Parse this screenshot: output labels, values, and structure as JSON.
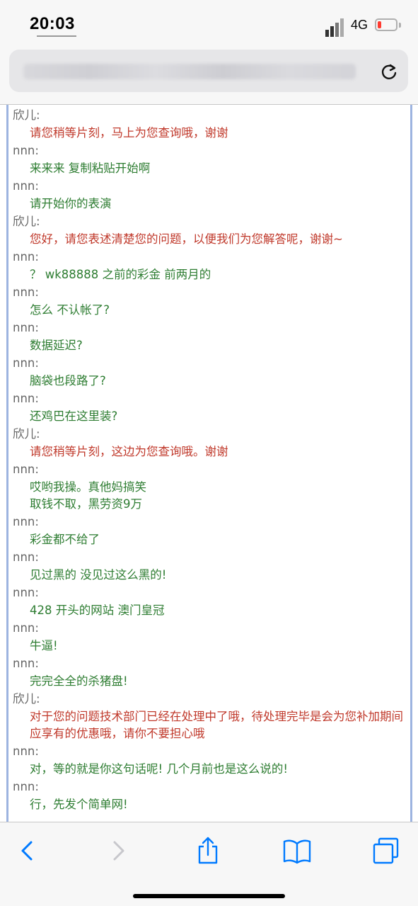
{
  "status_bar": {
    "time": "20:03",
    "network": "4G",
    "battery_level_pct": 10,
    "battery_color": "#ff3b30"
  },
  "browser": {
    "reload_icon": "reload-icon",
    "toolbar_icons": [
      "back-arrow-icon",
      "forward-arrow-icon",
      "share-icon",
      "bookmarks-icon",
      "tabs-icon"
    ]
  },
  "colors": {
    "agent_text": "#c0392b",
    "user_text": "#2e7d32",
    "frame_border": "#9db4e0",
    "accent": "#007aff"
  },
  "messages": [
    {
      "role": "agent",
      "sender": "欣儿:",
      "text": "请您稍等片刻，马上为您查询哦，谢谢"
    },
    {
      "role": "user",
      "sender": "nnn:",
      "text": "来来来 复制粘贴开始啊"
    },
    {
      "role": "user",
      "sender": "nnn:",
      "text": "请开始你的表演"
    },
    {
      "role": "agent",
      "sender": "欣儿:",
      "text": "您好，请您表述清楚您的问题，以便我们为您解答呢，谢谢~"
    },
    {
      "role": "user",
      "sender": "nnn:",
      "text": "？ wk88888 之前的彩金 前两月的"
    },
    {
      "role": "user",
      "sender": "nnn:",
      "text": "怎么 不认帐了?"
    },
    {
      "role": "user",
      "sender": "nnn:",
      "text": "数据延迟?"
    },
    {
      "role": "user",
      "sender": "nnn:",
      "text": "脑袋也段路了?"
    },
    {
      "role": "user",
      "sender": "nnn:",
      "text": "还鸡巴在这里装?"
    },
    {
      "role": "agent",
      "sender": "欣儿:",
      "text": "请您稍等片刻，这边为您查询哦。谢谢"
    },
    {
      "role": "user",
      "sender": "nnn:",
      "text": "哎哟我操。真他妈搞笑"
    },
    {
      "role": "user",
      "sender": "",
      "text": "取钱不取，黑劳资9万"
    },
    {
      "role": "user",
      "sender": "nnn:",
      "text": "彩金都不给了"
    },
    {
      "role": "user",
      "sender": "nnn:",
      "text": "见过黑的 没见过这么黑的!"
    },
    {
      "role": "user",
      "sender": "nnn:",
      "text": "428 开头的网站 澳门皇冠"
    },
    {
      "role": "user",
      "sender": "nnn:",
      "text": "牛逼!"
    },
    {
      "role": "user",
      "sender": "nnn:",
      "text": "完完全全的杀猪盘!"
    },
    {
      "role": "agent",
      "sender": "欣儿:",
      "text": "对于您的问题技术部门已经在处理中了哦，待处理完毕是会为您补加期间应享有的优惠哦，请你不要担心哦"
    },
    {
      "role": "user",
      "sender": "nnn:",
      "text": "对，等的就是你这句话呢! 几个月前也是这么说的!"
    },
    {
      "role": "user",
      "sender": "nnn:",
      "text": "行，先发个简单网!"
    }
  ]
}
